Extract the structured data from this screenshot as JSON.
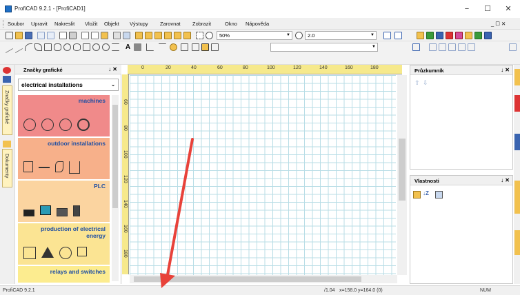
{
  "window": {
    "title": "ProfiCAD 9.2.1 - [ProfiCAD1]",
    "controls": {
      "minimize": "−",
      "maximize": "☐",
      "close": "✕"
    }
  },
  "menu": {
    "items": [
      "Soubor",
      "Upravit",
      "Nakreslit",
      "Vložit",
      "Objekt",
      "Výstupy",
      "Zarovnat",
      "Zobrazit",
      "Okno",
      "Nápověda"
    ],
    "right": "_ ☐ ✕"
  },
  "toolbar1": {
    "zoom_value": "50%",
    "grid_value": "2.0"
  },
  "toolbar2": {
    "text_label": "A"
  },
  "left_tabs": {
    "symbols": "Značky grafické",
    "documents": "Dokumenty"
  },
  "symbols_panel": {
    "title": "Značky grafické",
    "controls": "↓ ✕",
    "library": "electrical installations",
    "categories": [
      {
        "name": "machines",
        "color": "#f08a8a"
      },
      {
        "name": "outdoor installations",
        "color": "#f7b08a"
      },
      {
        "name": "PLC",
        "color": "#fbd4a0"
      },
      {
        "name": "production of electrical energy",
        "color": "#fbe493"
      },
      {
        "name": "relays and switches",
        "color": "#fcec8f"
      }
    ]
  },
  "ruler": {
    "h": [
      "0",
      "20",
      "40",
      "60",
      "80",
      "100",
      "120",
      "140",
      "160",
      "180"
    ],
    "v": [
      "60",
      "80",
      "100",
      "120",
      "140",
      "160",
      "180",
      "200"
    ]
  },
  "explorer": {
    "title": "Průzkumník",
    "controls": "↓ ✕"
  },
  "properties": {
    "title": "Vlastnosti",
    "controls": "↓ ✕"
  },
  "status": {
    "left": "ProfiCAD 9.2.1",
    "page": "/1.04",
    "coords": "x=158.0  y=164.0 (0)",
    "num": "NUM"
  },
  "colors": {
    "grid": "#b8dde6",
    "ruler": "#f6e98c",
    "arrow": "#e8423a"
  }
}
